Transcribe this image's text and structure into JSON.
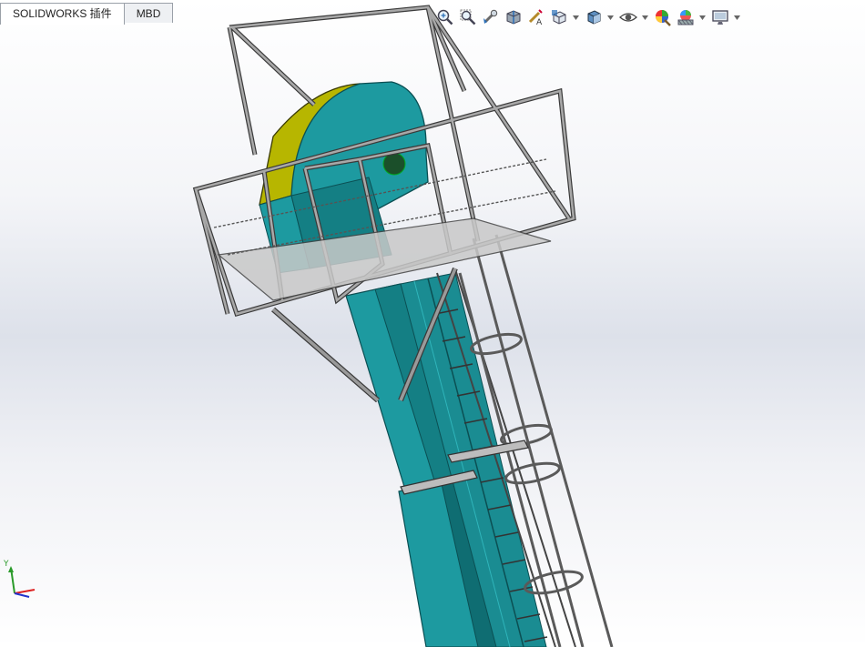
{
  "tabs": [
    {
      "label": "SOLIDWORKS 插件",
      "active": true
    },
    {
      "label": "MBD",
      "active": false
    }
  ],
  "heads_up_toolbar": [
    {
      "icon": "zoom-to-fit-icon"
    },
    {
      "icon": "zoom-to-area-icon"
    },
    {
      "icon": "previous-view-icon"
    },
    {
      "icon": "section-view-icon"
    },
    {
      "icon": "dynamic-annotation-views-icon"
    },
    {
      "icon": "view-orientation-icon",
      "dropdown": true
    },
    {
      "icon": "display-style-icon",
      "dropdown": true
    },
    {
      "icon": "hide-show-items-icon",
      "dropdown": true
    },
    {
      "icon": "edit-appearance-icon"
    },
    {
      "icon": "apply-scene-icon",
      "dropdown": true
    },
    {
      "icon": "view-settings-icon",
      "dropdown": true
    }
  ],
  "triad": {
    "axis_label": "Y"
  },
  "colors": {
    "body_teal": "#1d9aa0",
    "body_teal_dark": "#0f6d72",
    "hood_yellow": "#b7b600",
    "frame_gray": "#9a9a9a",
    "frame_outline": "#3a3a3a"
  }
}
